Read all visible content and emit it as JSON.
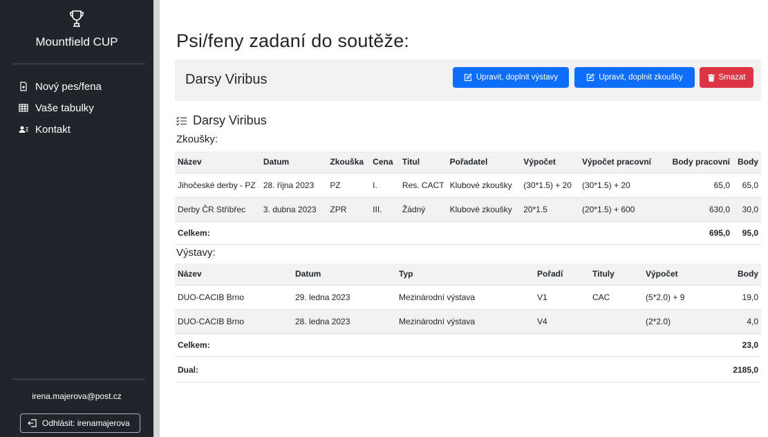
{
  "sidebar": {
    "brand": "Mountfield CUP",
    "nav": [
      {
        "label": "Nový pes/fena",
        "icon": "file-plus-icon"
      },
      {
        "label": "Vaše tabulky",
        "icon": "table-icon"
      },
      {
        "label": "Kontakt",
        "icon": "contacts-icon"
      }
    ],
    "user_email": "irena.majerova@post.cz",
    "logout_label": "Odhlásit: irenamajerova"
  },
  "main": {
    "page_title": "Psi/feny zadaní do soutěže:",
    "dog_name": "Darsy Viribus",
    "buttons": {
      "edit_shows": "Upravit, doplnit výstavy",
      "edit_trials": "Upravit, doplnit zkoušky",
      "delete": "Smazat"
    },
    "detail_title": "Darsy Viribus",
    "trials": {
      "heading": "Zkoušky:",
      "columns": [
        "Název",
        "Datum",
        "Zkouška",
        "Cena",
        "Titul",
        "Pořadatel",
        "Výpočet",
        "Výpočet pracovní",
        "Body pracovní",
        "Body"
      ],
      "rows": [
        [
          "Jihočeské derby - PZ",
          "28. října 2023",
          "PZ",
          "I.",
          "Res. CACT",
          "Klubové zkoušky",
          "(30*1.5) + 20",
          "(30*1.5) + 20",
          "65,0",
          "65,0"
        ],
        [
          "Derby ČR Stříbřec",
          "3. dubna 2023",
          "ZPR",
          "III.",
          "Žádný",
          "Klubové zkoušky",
          "20*1.5",
          "(20*1.5) + 600",
          "630,0",
          "30,0"
        ]
      ],
      "total_label": "Celkem:",
      "total_work": "695,0",
      "total_points": "95,0"
    },
    "shows": {
      "heading": "Výstavy:",
      "columns": [
        "Název",
        "Datum",
        "Typ",
        "Pořadí",
        "Tituly",
        "Výpočet",
        "Body"
      ],
      "rows": [
        [
          "DUO-CACIB Brno",
          "29. ledna 2023",
          "Mezinárodní výstava",
          "V1",
          "CAC",
          "(5*2.0) + 9",
          "19,0"
        ],
        [
          "DUO-CACIB Brno",
          "28. ledna 2023",
          "Mezinárodní výstava",
          "V4",
          "",
          "(2*2.0)",
          "4,0"
        ]
      ],
      "total_label": "Celkem:",
      "total_points": "23,0"
    },
    "dual": {
      "label": "Dual:",
      "value": "2185,0"
    }
  },
  "colors": {
    "sidebar_bg": "#212529",
    "primary": "#0d6efd",
    "danger": "#dc3545",
    "header_bg": "#f1f1f1"
  }
}
